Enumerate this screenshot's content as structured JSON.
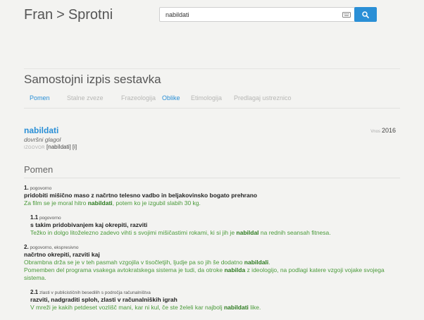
{
  "header": {
    "site": "Fran",
    "separator": ">",
    "section": "Sprotni"
  },
  "search": {
    "value": "nabildati",
    "keyboard_icon": "keyboard-icon",
    "search_icon": "search-icon"
  },
  "page": {
    "title": "Samostojni izpis sestavka"
  },
  "tabs": [
    {
      "label": "Pomen",
      "active": true
    },
    {
      "label": "Stalne zveze",
      "active": false
    },
    {
      "label": "Frazeologija",
      "active": false
    },
    {
      "label": "Oblike",
      "active": true
    },
    {
      "label": "Etimologija",
      "active": false
    },
    {
      "label": "Predlagaj ustreznico",
      "active": false
    }
  ],
  "entry": {
    "headword": "nabildati",
    "grammar": "dovršni glagol",
    "pron_label": "IZGOVOR",
    "pronunciation": "[nabíldati] [i]",
    "source_label": "Vnos",
    "source_year": "2016"
  },
  "pomen_heading": "Pomen",
  "senses": [
    {
      "num": "1.",
      "qualifier": "pogovorno",
      "definition": "pridobiti mišično maso z načrtno telesno vadbo in beljakovinsko bogato prehrano",
      "example": {
        "pre": "Za film se je moral hitro ",
        "bold": "nabildati",
        "post": ", potem ko je izgubil slabih 30 kg."
      }
    },
    {
      "num": "1.1",
      "qualifier": "pogovorno",
      "definition": "s takim pridobivanjem kaj okrepiti, razviti",
      "example": {
        "pre": "Težko in dolgo litoželezno zadevo vihti s svojimi mišičastimi rokami, ki si jih je ",
        "bold": "nabildal",
        "post": " na rednih seansah fitnesa."
      }
    },
    {
      "num": "2.",
      "qualifier": "pogovorno, ekspresivno",
      "definition": "načrtno okrepiti, razviti kaj",
      "examples": [
        {
          "pre": "Obrambna drža se je v teh pasmah vzgojila v tisočletjih, ljudje pa so jih še dodatno ",
          "bold": "nabildali",
          "post": "."
        },
        {
          "pre": "Pomemben del programa vsakega avtokratskega sistema je tudi, da otroke ",
          "bold": "nabilda",
          "post": " z ideologijo, na podlagi katere vzgoji vojake svojega sistema."
        }
      ]
    },
    {
      "num": "2.1",
      "qualifier": "zlasti v publicističnih besedilih s področja računalništva",
      "definition": "razviti, nadgraditi sploh, zlasti v računalniških igrah",
      "example": {
        "pre": "V mreži je kakih petdeset vozlišč mani, kar ni kul, če ste želeli kar najbolj ",
        "bold": "nabildati",
        "post": " like."
      }
    }
  ],
  "colors": {
    "accent": "#2a8fd6",
    "example_green": "#4a9a3a",
    "background": "#f3f3f1"
  }
}
